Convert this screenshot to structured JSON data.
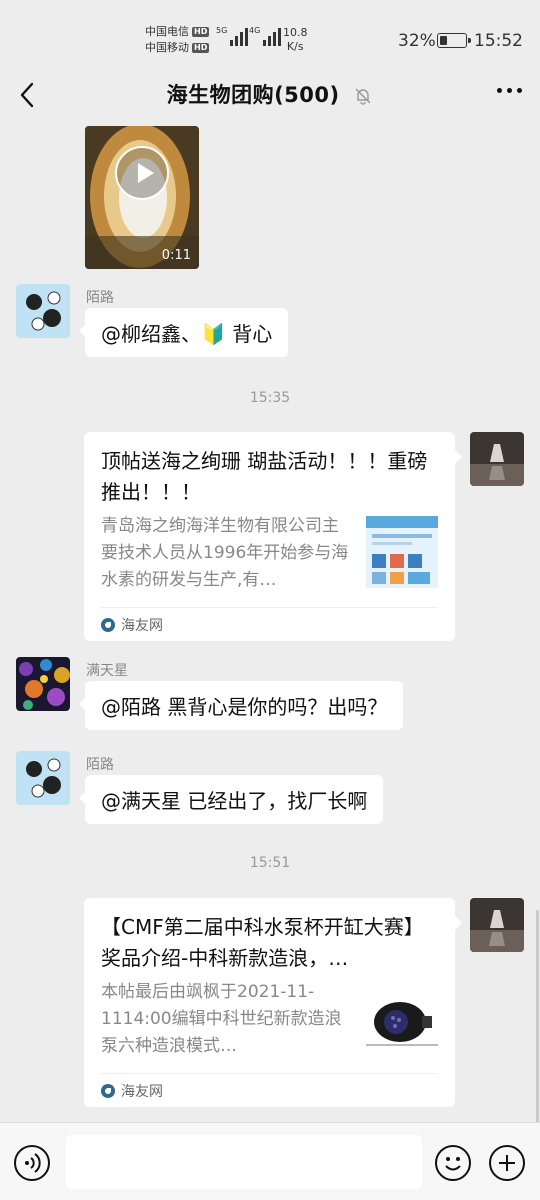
{
  "status_bar": {
    "carrier_1": "中国电信",
    "carrier_2": "中国移动",
    "hd_badge": "HD",
    "net_1": "5G",
    "net_2": "4G",
    "speed_value": "10.8",
    "speed_unit": "K/s",
    "battery": "32%",
    "battery_level": 0.32,
    "time": "15:52"
  },
  "header": {
    "title": "海生物团购(500)",
    "icons": [
      "back-icon",
      "bell-muted-icon",
      "more-icon"
    ]
  },
  "messages": {
    "video": {
      "duration": "0:11"
    },
    "msg1": {
      "sender": "陌路",
      "text": "@柳绍鑫、🔰 背心"
    },
    "time1": "15:35",
    "card1": {
      "title": "顶帖送海之绚珊 瑚盐活动！！！重磅推出！！！",
      "desc": "青岛海之绚海洋生物有限公司主要技术人员从1996年开始参与海水素的研发与生产,有…",
      "source": "海友网"
    },
    "msg2": {
      "sender": "满天星",
      "text": "@陌路  黑背心是你的吗？出吗？"
    },
    "msg3": {
      "sender": "陌路",
      "text": "@满天星  已经出了，找厂长啊"
    },
    "time2": "15:51",
    "card2": {
      "title": "【CMF第二届中科水泵杯开缸大赛】奖品介绍-中科新款造浪，…",
      "desc": "本帖最后由飒枫于2021-11-1114:00编辑中科世纪新款造浪泵六种造浪模式…",
      "source": "海友网"
    }
  },
  "input_bar": {
    "message_value": "",
    "icons": [
      "voice-icon",
      "emoji-icon",
      "plus-icon"
    ]
  }
}
